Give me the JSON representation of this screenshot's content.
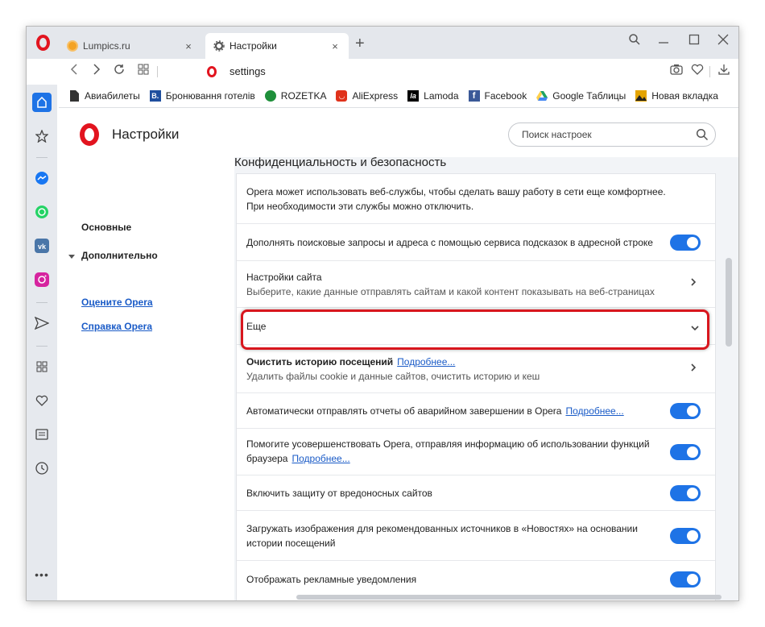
{
  "tabs": [
    {
      "title": "Lumpics.ru",
      "close": "×"
    },
    {
      "title": "Настройки",
      "close": "×"
    }
  ],
  "new_tab": "+",
  "window_controls": {
    "search": "⌕",
    "minimize": "—",
    "maximize": "☐",
    "close": "✕"
  },
  "address": {
    "back": "<",
    "forward": ">",
    "reload": "C",
    "url": "settings"
  },
  "bookmarks": [
    {
      "label": "Авиабилеты",
      "icon": "document-icon",
      "color": "#333333"
    },
    {
      "label": "Бронювання готелів",
      "icon": "booking-icon",
      "color": "#1f4f9e"
    },
    {
      "label": "ROZETKA",
      "icon": "rozetka-icon",
      "color": "#1e8f3a"
    },
    {
      "label": "AliExpress",
      "icon": "aliexpress-icon",
      "color": "#e0321b"
    },
    {
      "label": "Lamoda",
      "icon": "lamoda-icon",
      "color": "#000000"
    },
    {
      "label": "Facebook",
      "icon": "facebook-icon",
      "color": "#3b5998"
    },
    {
      "label": "Google Таблицы",
      "icon": "google-drive-icon",
      "color": "#1fa463"
    },
    {
      "label": "Новая вкладка",
      "icon": "new-tab-image-icon",
      "color": "#e4a400"
    }
  ],
  "settings_header": {
    "title": "Настройки",
    "search_placeholder": "Поиск настроек"
  },
  "settings_nav": {
    "basic": "Основные",
    "advanced": "Дополнительно",
    "rate": "Оцените Opera",
    "help": "Справка Opera"
  },
  "section_title": "Конфиденциальность и безопасность",
  "rows": {
    "intro": "Opera может использовать веб-службы, чтобы сделать вашу работу в сети еще комфортнее. При необходимости эти службы можно отключить.",
    "suggest": "Дополнять поисковые запросы и адреса с помощью сервиса подсказок в адресной строке",
    "site_settings_title": "Настройки сайта",
    "site_settings_sub": "Выберите, какие данные отправлять сайтам и какой контент показывать на веб-страницах",
    "more": "Еще",
    "clear_title": "Очистить историю посещений",
    "clear_link": "Подробнее...",
    "clear_sub": "Удалить файлы cookie и данные сайтов, очистить историю и кеш",
    "crash": "Автоматически отправлять отчеты об аварийном завершении в Opera",
    "crash_link": "Подробнее...",
    "improve": "Помогите усовершенствовать Opera, отправляя информацию об использовании функций браузера",
    "improve_link": "Подробнее...",
    "malware": "Включить защиту от вредоносных сайтов",
    "news_images": "Загружать изображения для рекомендованных источников в «Новостях» на основании истории посещений",
    "ads": "Отображать рекламные уведомления"
  },
  "toggles": {
    "suggest": true,
    "crash": true,
    "improve": true,
    "malware": true,
    "news_images": true,
    "ads": true
  },
  "colors": {
    "accent": "#1e73e6",
    "opera_red": "#e2141f",
    "highlight": "#d8161e",
    "link": "#1a5bc7"
  }
}
